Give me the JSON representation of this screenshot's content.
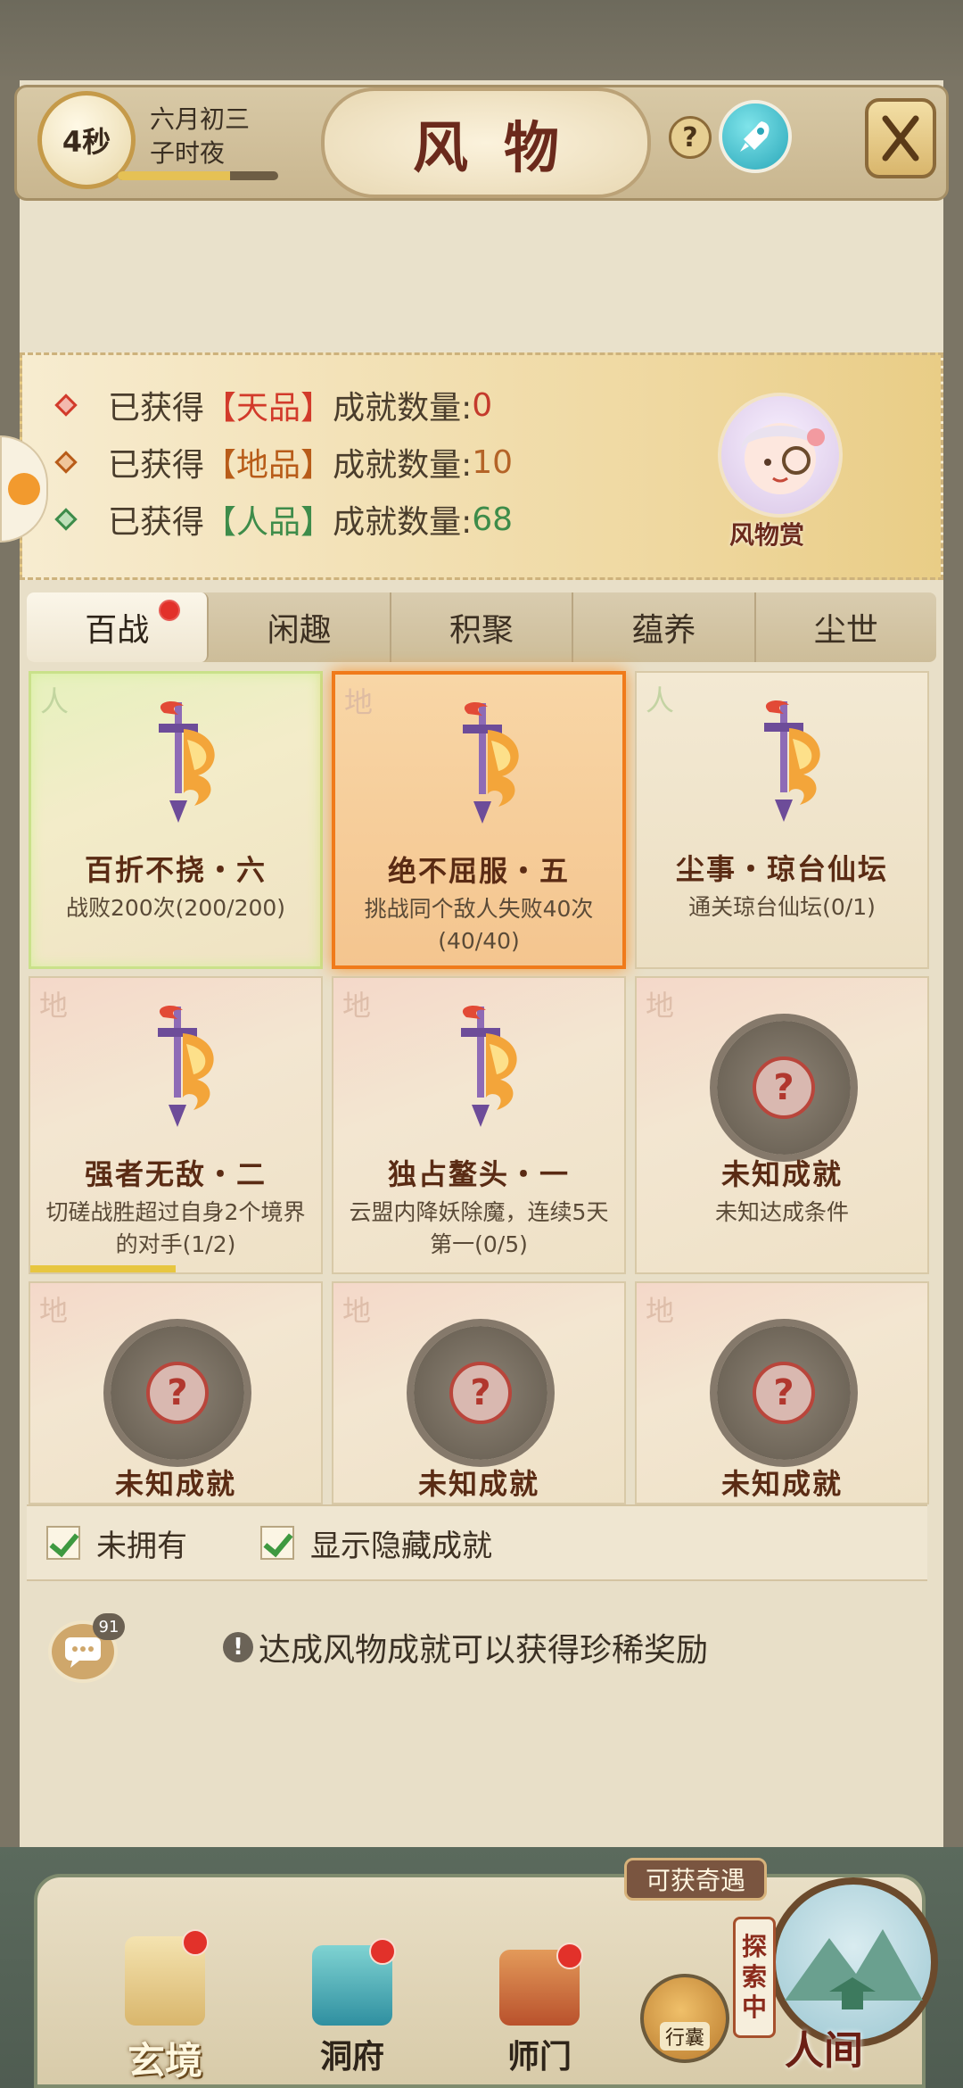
{
  "header": {
    "timer": "4秒",
    "date_line1": "六月初三",
    "date_line2": "子时夜",
    "date_progress": 0.7,
    "title": "风物",
    "help_symbol": "?",
    "icons": [
      "help-icon",
      "rocket-icon",
      "close-icon"
    ]
  },
  "summary": {
    "prefix": "已获得",
    "suffix": "成就数量:",
    "rows": [
      {
        "open": "【",
        "grade": "天品",
        "close": "】",
        "count": "0"
      },
      {
        "open": "【",
        "grade": "地品",
        "close": "】",
        "count": "10"
      },
      {
        "open": "【",
        "grade": "人品",
        "close": "】",
        "count": "68"
      }
    ],
    "mascot_label": "风物赏",
    "colors": {
      "tian": "#d23b2b",
      "di": "#b85c19",
      "ren": "#3e8c4a"
    }
  },
  "tabs": [
    {
      "label": "百战",
      "active": true,
      "badge": true
    },
    {
      "label": "闲趣"
    },
    {
      "label": "积聚"
    },
    {
      "label": "蕴养"
    },
    {
      "label": "尘世"
    }
  ],
  "cards": [
    {
      "corner": "人",
      "title": "百折不挠・六",
      "desc": "战败200次(200/200)",
      "state": "green",
      "icon": "sword-flame-icon"
    },
    {
      "corner": "地",
      "title": "绝不屈服・五",
      "desc": "挑战同个敌人失败40次(40/40)",
      "state": "orange",
      "icon": "sword-flame-icon"
    },
    {
      "corner": "人",
      "title": "尘事・琼台仙坛",
      "desc": "通关琼台仙坛(0/1)",
      "state": "normal",
      "icon": "sword-flame-icon"
    },
    {
      "corner": "地",
      "title": "强者无敌・二",
      "desc": "切磋战胜超过自身2个境界的对手(1/2)",
      "state": "red",
      "progress": 0.5,
      "icon": "sword-flame-icon"
    },
    {
      "corner": "地",
      "title": "独占鳌头・一",
      "desc": "云盟内降妖除魔，连续5天第一(0/5)",
      "state": "red",
      "icon": "sword-flame-icon"
    },
    {
      "corner": "地",
      "title": "未知成就",
      "desc": "未知达成条件",
      "state": "unknown-red",
      "icon": "unknown-icon"
    },
    {
      "corner": "地",
      "title": "未知成就",
      "desc": "",
      "state": "unknown-red",
      "icon": "unknown-icon"
    },
    {
      "corner": "地",
      "title": "未知成就",
      "desc": "",
      "state": "unknown-red",
      "icon": "unknown-icon"
    },
    {
      "corner": "地",
      "title": "未知成就",
      "desc": "",
      "state": "unknown-red",
      "icon": "unknown-icon"
    }
  ],
  "options": {
    "not_owned": "未拥有",
    "show_hidden": "显示隐藏成就"
  },
  "chat": {
    "count": "91"
  },
  "tip": {
    "icon": "!",
    "text": "达成风物成就可以获得珍稀奖励"
  },
  "bottom_nav": {
    "adventure_label": "可获奇遇",
    "explore": [
      "探",
      "索",
      "中"
    ],
    "items": [
      {
        "label": "玄境",
        "badge": true,
        "icon": "scroll-icon"
      },
      {
        "label": "洞府",
        "badge": true,
        "icon": "lantern-pavilion-icon"
      },
      {
        "label": "师门",
        "badge": true,
        "icon": "banner-icon"
      }
    ],
    "bag_label": "行囊",
    "world_label": "人间"
  }
}
